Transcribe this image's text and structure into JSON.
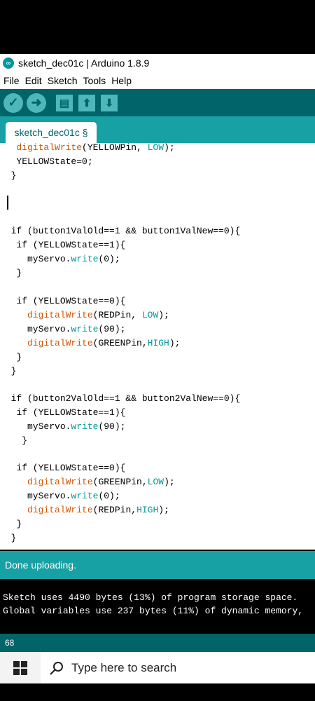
{
  "window": {
    "title": "sketch_dec01c | Arduino 1.8.9"
  },
  "menu": [
    "File",
    "Edit",
    "Sketch",
    "Tools",
    "Help"
  ],
  "toolbar": {
    "verify_icon": "check-icon",
    "upload_icon": "arrow-right-icon",
    "new_icon": "new-file-icon",
    "open_icon": "open-arrow-up-icon",
    "save_icon": "save-arrow-down-icon"
  },
  "tab": {
    "label": "sketch_dec01c §"
  },
  "status": {
    "message": "Done uploading."
  },
  "console": {
    "lines": [
      "Sketch uses 4490 bytes (13%) of program storage space.",
      "Global variables use 237 bytes (11%) of dynamic memory,"
    ]
  },
  "line_indicator": "68",
  "taskbar": {
    "search_placeholder": "Type here to search"
  },
  "colors": {
    "teal_dark": "#006468",
    "teal": "#17a1a5",
    "teal_light": "#4db7bb",
    "function_orange": "#d35400",
    "keyword_teal": "#00979c"
  }
}
